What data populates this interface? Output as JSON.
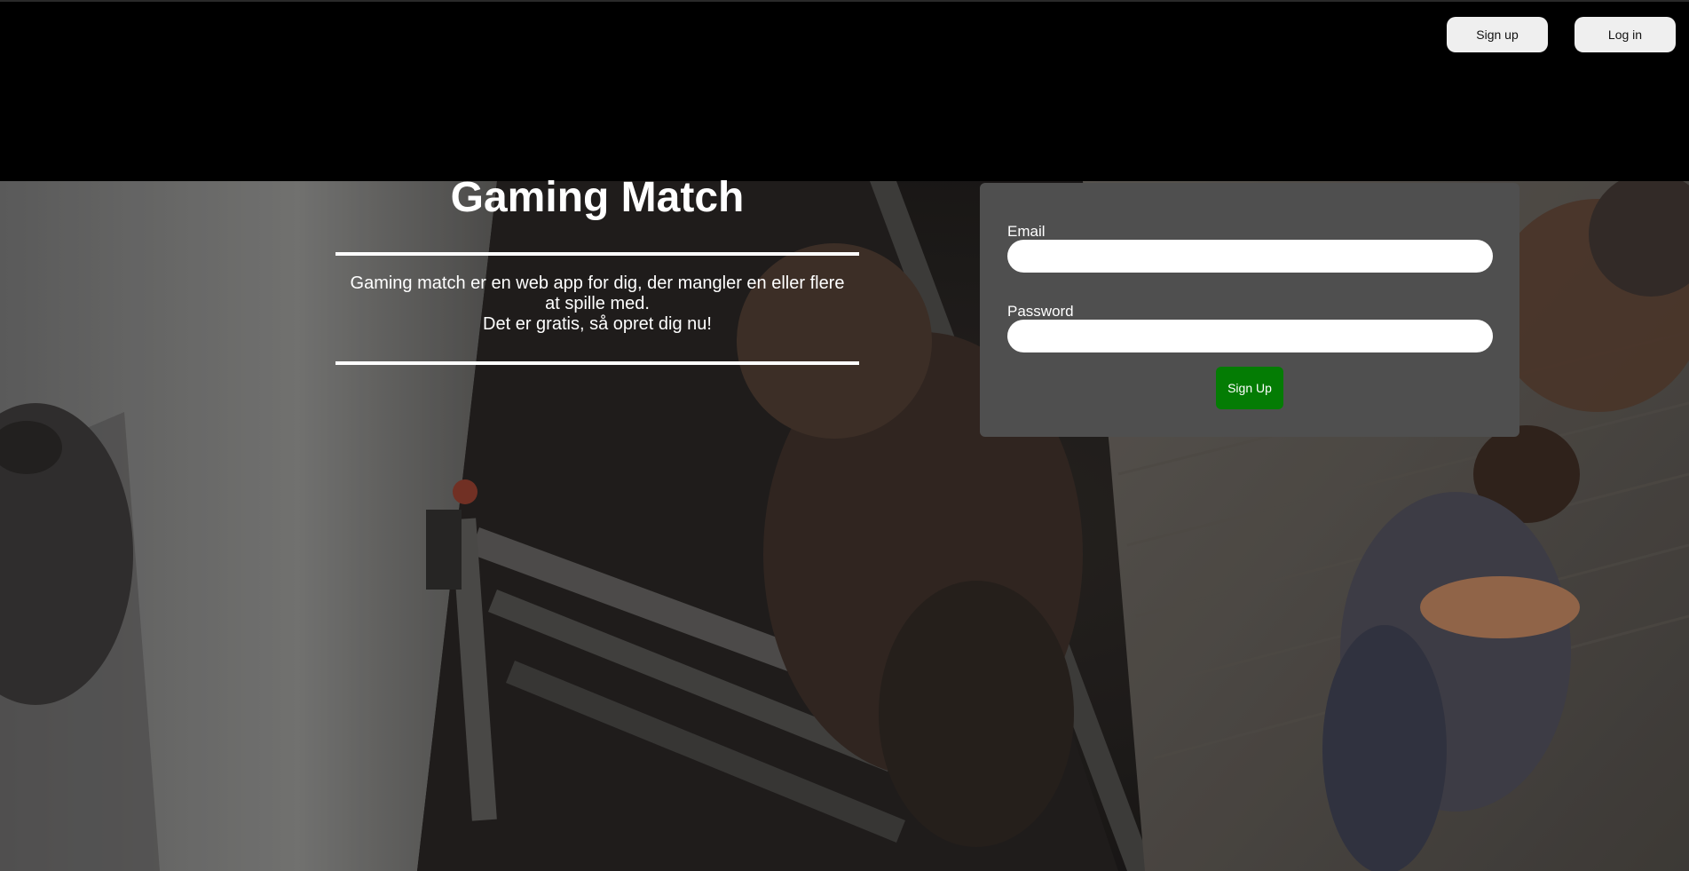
{
  "header": {
    "signup_label": "Sign up",
    "login_label": "Log in"
  },
  "hero": {
    "title": "Gaming Match",
    "description_line1": "Gaming match er en web app for dig, der mangler en eller flere at spille med.",
    "description_line2": "Det er gratis, så opret dig nu!"
  },
  "form": {
    "email_label": "Email",
    "email_value": "",
    "password_label": "Password",
    "password_value": "",
    "submit_label": "Sign Up"
  },
  "colors": {
    "header_bg": "#000000",
    "panel_bg": "#4f4f4f",
    "submit_bg": "#047c04",
    "nav_button_bg": "#efefef"
  }
}
